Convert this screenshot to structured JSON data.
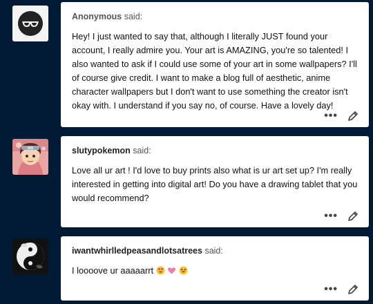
{
  "asks": [
    {
      "asker": "Anonymous",
      "said": "said:",
      "avatar_icon": "anonymous-sunglasses-icon",
      "question": "Hey! I just wanted to say that, although I literally JUST found your account, I really admire you. Your art is AMAZING, you're so talented! I also wanted to ask if I could use some of your art in some wallpapers? I'll of course give credit. I want to make a blog full of aesthetic, anime character wallpapers but I don't want to use something the creator isn't okay with. I understand if you say no, of course. Have a lovely day!"
    },
    {
      "asker": "slutypokemon",
      "said": "said:",
      "avatar_icon": "anime-character-avatar",
      "question": "Love all ur art ! I'd love to buy prints also what is ur art set up? I'm really interested in getting into digital art! Do you have a drawing tablet that you would recommend?"
    },
    {
      "asker": "iwantwhirlledpeasandlotsatrees",
      "said": "said:",
      "avatar_icon": "yin-yang-avatar",
      "question": "I loooove ur aaaaarrt"
    }
  ],
  "colors": {
    "background": "#001935",
    "card": "#ffffff"
  }
}
